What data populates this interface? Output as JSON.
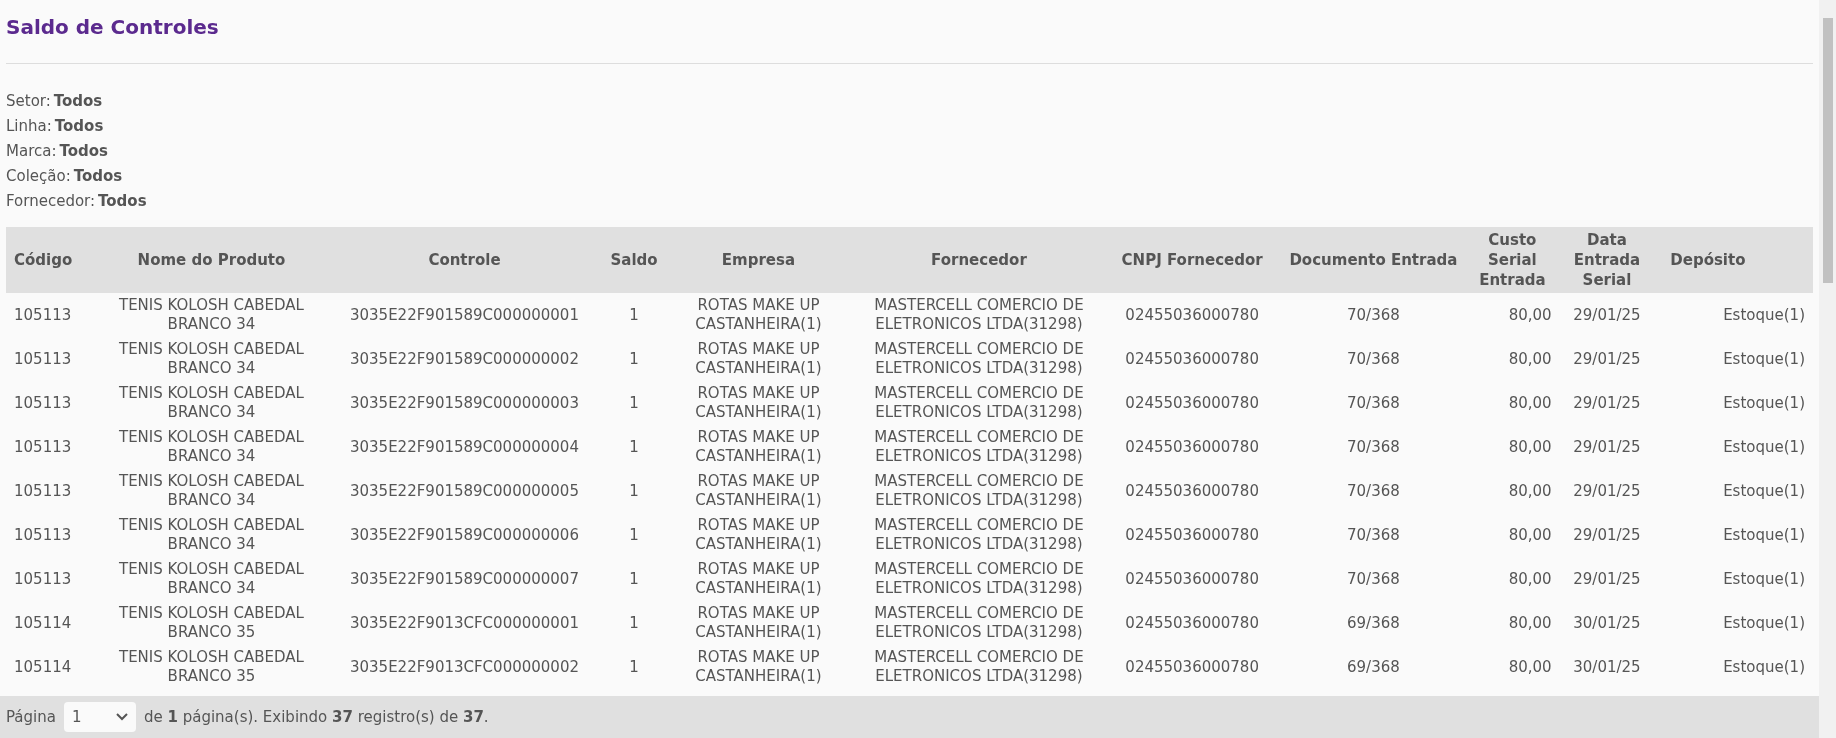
{
  "page": {
    "title": "Saldo de Controles"
  },
  "filters": [
    {
      "label": "Setor:",
      "value": "Todos"
    },
    {
      "label": "Linha:",
      "value": "Todos"
    },
    {
      "label": "Marca:",
      "value": "Todos"
    },
    {
      "label": "Coleção:",
      "value": "Todos"
    },
    {
      "label": "Fornecedor:",
      "value": "Todos"
    }
  ],
  "table": {
    "columns": [
      "Código",
      "Nome do Produto",
      "Controle",
      "Saldo",
      "Empresa",
      "Fornecedor",
      "CNPJ Fornecedor",
      "Documento Entrada",
      "Custo Serial Entrada",
      "Data Entrada Serial",
      "Depósito"
    ],
    "rows": [
      [
        "105113",
        "TENIS KOLOSH CABEDAL BRANCO 34",
        "3035E22F901589C000000001",
        "1",
        "ROTAS MAKE UP CASTANHEIRA(1)",
        "MASTERCELL COMERCIO DE ELETRONICOS LTDA(31298)",
        "02455036000780",
        "70/368",
        "80,00",
        "29/01/25",
        "Estoque(1)"
      ],
      [
        "105113",
        "TENIS KOLOSH CABEDAL BRANCO 34",
        "3035E22F901589C000000002",
        "1",
        "ROTAS MAKE UP CASTANHEIRA(1)",
        "MASTERCELL COMERCIO DE ELETRONICOS LTDA(31298)",
        "02455036000780",
        "70/368",
        "80,00",
        "29/01/25",
        "Estoque(1)"
      ],
      [
        "105113",
        "TENIS KOLOSH CABEDAL BRANCO 34",
        "3035E22F901589C000000003",
        "1",
        "ROTAS MAKE UP CASTANHEIRA(1)",
        "MASTERCELL COMERCIO DE ELETRONICOS LTDA(31298)",
        "02455036000780",
        "70/368",
        "80,00",
        "29/01/25",
        "Estoque(1)"
      ],
      [
        "105113",
        "TENIS KOLOSH CABEDAL BRANCO 34",
        "3035E22F901589C000000004",
        "1",
        "ROTAS MAKE UP CASTANHEIRA(1)",
        "MASTERCELL COMERCIO DE ELETRONICOS LTDA(31298)",
        "02455036000780",
        "70/368",
        "80,00",
        "29/01/25",
        "Estoque(1)"
      ],
      [
        "105113",
        "TENIS KOLOSH CABEDAL BRANCO 34",
        "3035E22F901589C000000005",
        "1",
        "ROTAS MAKE UP CASTANHEIRA(1)",
        "MASTERCELL COMERCIO DE ELETRONICOS LTDA(31298)",
        "02455036000780",
        "70/368",
        "80,00",
        "29/01/25",
        "Estoque(1)"
      ],
      [
        "105113",
        "TENIS KOLOSH CABEDAL BRANCO 34",
        "3035E22F901589C000000006",
        "1",
        "ROTAS MAKE UP CASTANHEIRA(1)",
        "MASTERCELL COMERCIO DE ELETRONICOS LTDA(31298)",
        "02455036000780",
        "70/368",
        "80,00",
        "29/01/25",
        "Estoque(1)"
      ],
      [
        "105113",
        "TENIS KOLOSH CABEDAL BRANCO 34",
        "3035E22F901589C000000007",
        "1",
        "ROTAS MAKE UP CASTANHEIRA(1)",
        "MASTERCELL COMERCIO DE ELETRONICOS LTDA(31298)",
        "02455036000780",
        "70/368",
        "80,00",
        "29/01/25",
        "Estoque(1)"
      ],
      [
        "105114",
        "TENIS KOLOSH CABEDAL BRANCO 35",
        "3035E22F9013CFC000000001",
        "1",
        "ROTAS MAKE UP CASTANHEIRA(1)",
        "MASTERCELL COMERCIO DE ELETRONICOS LTDA(31298)",
        "02455036000780",
        "69/368",
        "80,00",
        "30/01/25",
        "Estoque(1)"
      ],
      [
        "105114",
        "TENIS KOLOSH CABEDAL BRANCO 35",
        "3035E22F9013CFC000000002",
        "1",
        "ROTAS MAKE UP CASTANHEIRA(1)",
        "MASTERCELL COMERCIO DE ELETRONICOS LTDA(31298)",
        "02455036000780",
        "69/368",
        "80,00",
        "30/01/25",
        "Estoque(1)"
      ]
    ]
  },
  "pagination": {
    "label": "Página",
    "page_select": "1",
    "summary": "de **1** página(s). Exibindo **37** registro(s) de **37**."
  }
}
